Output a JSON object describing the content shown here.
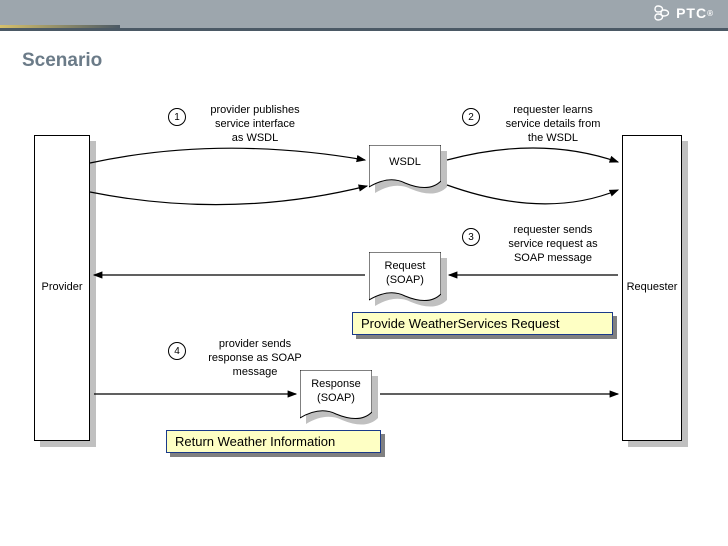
{
  "header": {
    "brand": "PTC",
    "reg": "®"
  },
  "title": "Scenario",
  "actors": {
    "provider": "Provider",
    "requester": "Requester"
  },
  "docs": {
    "wsdl": "WSDL",
    "request": "Request\n(SOAP)",
    "response": "Response\n(SOAP)"
  },
  "steps": {
    "s1": {
      "num": "1",
      "text": "provider publishes\nservice interface\nas WSDL"
    },
    "s2": {
      "num": "2",
      "text": "requester learns\nservice details from\nthe WSDL"
    },
    "s3": {
      "num": "3",
      "text": "requester sends\nservice request as\nSOAP message"
    },
    "s4": {
      "num": "4",
      "text": "provider sends\nresponse as SOAP\nmessage"
    }
  },
  "notes": {
    "req": "Provide WeatherServices Request",
    "res": "Return Weather Information"
  }
}
